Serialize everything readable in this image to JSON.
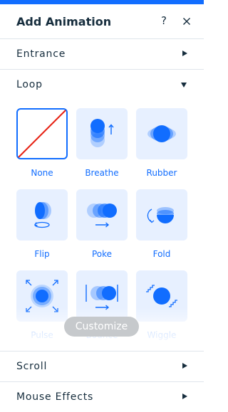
{
  "header": {
    "title": "Add Animation",
    "help_label": "?"
  },
  "sections": [
    {
      "label": "Entrance",
      "expanded": false
    },
    {
      "label": "Loop",
      "expanded": true
    },
    {
      "label": "Scroll",
      "expanded": false
    },
    {
      "label": "Mouse Effects",
      "expanded": false
    }
  ],
  "loop_presets": [
    {
      "label": "None",
      "icon": "none-icon",
      "selected": true
    },
    {
      "label": "Breathe",
      "icon": "breathe-icon",
      "selected": false
    },
    {
      "label": "Rubber",
      "icon": "rubber-icon",
      "selected": false
    },
    {
      "label": "Flip",
      "icon": "flip-icon",
      "selected": false
    },
    {
      "label": "Poke",
      "icon": "poke-icon",
      "selected": false
    },
    {
      "label": "Fold",
      "icon": "fold-icon",
      "selected": false
    },
    {
      "label": "Pulse",
      "icon": "pulse-icon",
      "selected": false
    },
    {
      "label": "Bounce",
      "icon": "bounce-icon",
      "selected": false
    },
    {
      "label": "Wiggle",
      "icon": "wiggle-icon",
      "selected": false
    }
  ],
  "customize_label": "Customize",
  "colors": {
    "accent": "#116dff",
    "tile_bg": "#e7f0ff",
    "none_slash": "#e62214",
    "customize_bg": "#c6c9cc"
  }
}
